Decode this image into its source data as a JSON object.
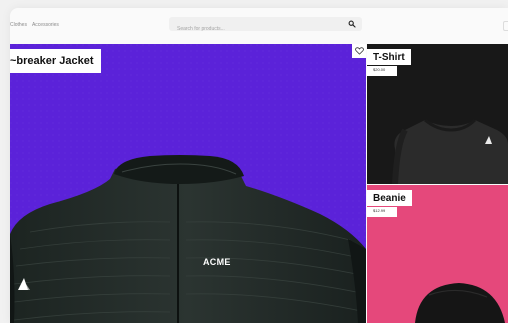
{
  "header": {
    "nav": [
      "Clothes",
      "Accessories"
    ],
    "search": {
      "placeholder": "Search for products...",
      "icon": "search-icon"
    }
  },
  "hero": {
    "title": "~breaker Jacket",
    "brand_print": "ACME",
    "wishlist_icon": "heart-icon",
    "background": "#5b22d9"
  },
  "products": [
    {
      "name": "T-Shirt",
      "price": "$20.00",
      "background": "#181818"
    },
    {
      "name": "Beanie",
      "price": "$12.99",
      "background": "#e5487b"
    }
  ]
}
